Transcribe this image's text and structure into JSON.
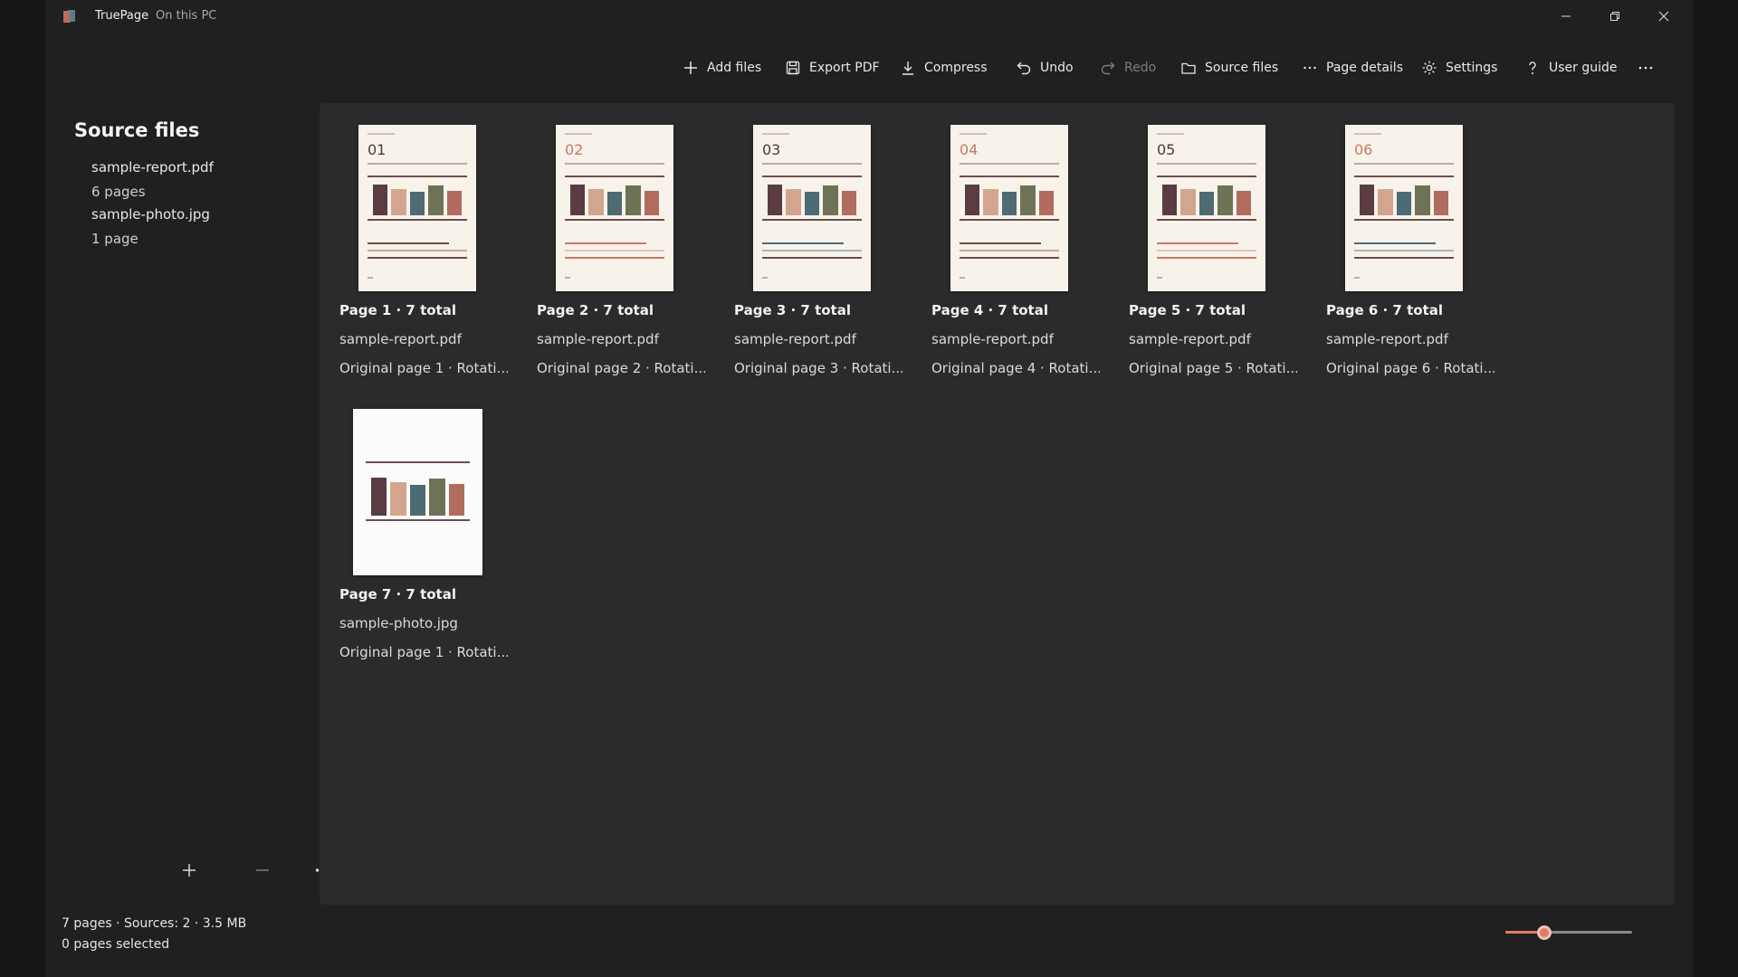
{
  "window": {
    "title": "TruePage",
    "subtitle": "On this PC",
    "minimize_icon": "minimize-icon",
    "maximize_icon": "restore-icon",
    "close_icon": "close-icon"
  },
  "toolbar": {
    "add_files": "Add files",
    "export_pdf": "Export PDF",
    "compress": "Compress",
    "undo": "Undo",
    "redo": "Redo",
    "source_files": "Source files",
    "page_details": "Page details",
    "settings": "Settings",
    "user_guide": "User guide",
    "more_icon": "more-icon"
  },
  "sidebar": {
    "title": "Source files",
    "files": [
      {
        "name": "sample-report.pdf",
        "meta": "6 pages"
      },
      {
        "name": "sample-photo.jpg",
        "meta": "1 page"
      }
    ],
    "actions": [
      "add-icon",
      "remove-icon",
      "more-icon"
    ]
  },
  "pages": [
    {
      "number": "01",
      "title": "Page 1 · 7 total",
      "file": "sample-report.pdf",
      "original": "Original page 1 · Rotati..."
    },
    {
      "number": "02",
      "title": "Page 2 · 7 total",
      "file": "sample-report.pdf",
      "original": "Original page 2 · Rotati..."
    },
    {
      "number": "03",
      "title": "Page 3 · 7 total",
      "file": "sample-report.pdf",
      "original": "Original page 3 · Rotati..."
    },
    {
      "number": "04",
      "title": "Page 4 · 7 total",
      "file": "sample-report.pdf",
      "original": "Original page 4 · Rotati..."
    },
    {
      "number": "05",
      "title": "Page 5 · 7 total",
      "file": "sample-report.pdf",
      "original": "Original page 5 · Rotati..."
    },
    {
      "number": "06",
      "title": "Page 6 · 7 total",
      "file": "sample-report.pdf",
      "original": "Original page 6 · Rotati..."
    },
    {
      "number": "",
      "title": "Page 7 · 7 total",
      "file": "sample-photo.jpg",
      "original": "Original page 1 · Rotati..."
    }
  ],
  "status": {
    "summary": "7 pages · Sources: 2 · 3.5 MB",
    "selection": "0 pages selected"
  },
  "zoom": {
    "level": 0.31
  },
  "colors": {
    "accent": "#e07b66",
    "bars": [
      "#5a3c42",
      "#d3a58e",
      "#4e6a72",
      "#6f7355",
      "#b06c5f"
    ]
  }
}
